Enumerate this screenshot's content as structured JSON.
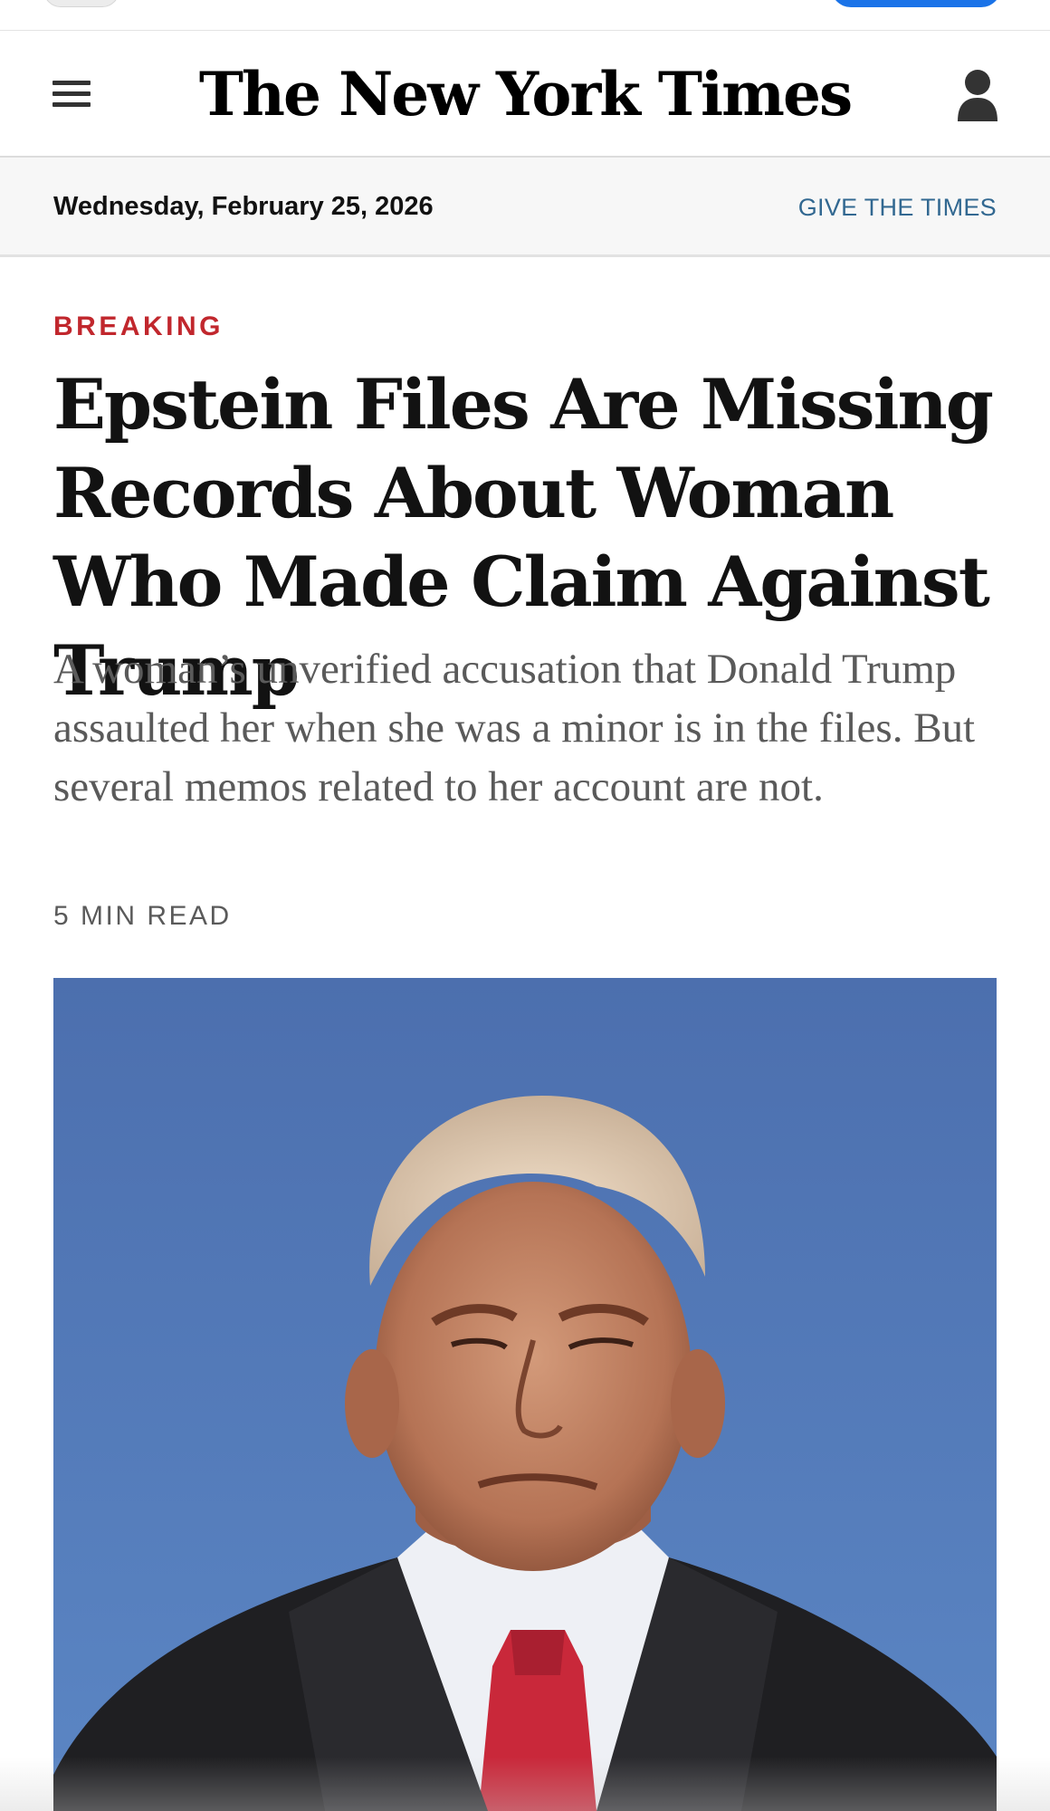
{
  "masthead": {
    "logo_text": "The New York Times",
    "menu_icon": "hamburger-menu-icon",
    "account_icon": "user-account-icon"
  },
  "datebar": {
    "date": "Wednesday, February 25, 2026",
    "give_link": "GIVE THE TIMES"
  },
  "article": {
    "kicker": "BREAKING",
    "headline": "Epstein Files Are Missing Records About Woman Who Made Claim Against Trump",
    "summary": "A woman’s unverified accusation that Donald Trump assaulted her when she was a minor is in the files. But several memos related to her account are not.",
    "read_time": "5 MIN READ"
  },
  "colors": {
    "kicker_red": "#c1272d",
    "link_blue": "#326891",
    "sky_blue": "#4d74b1"
  }
}
